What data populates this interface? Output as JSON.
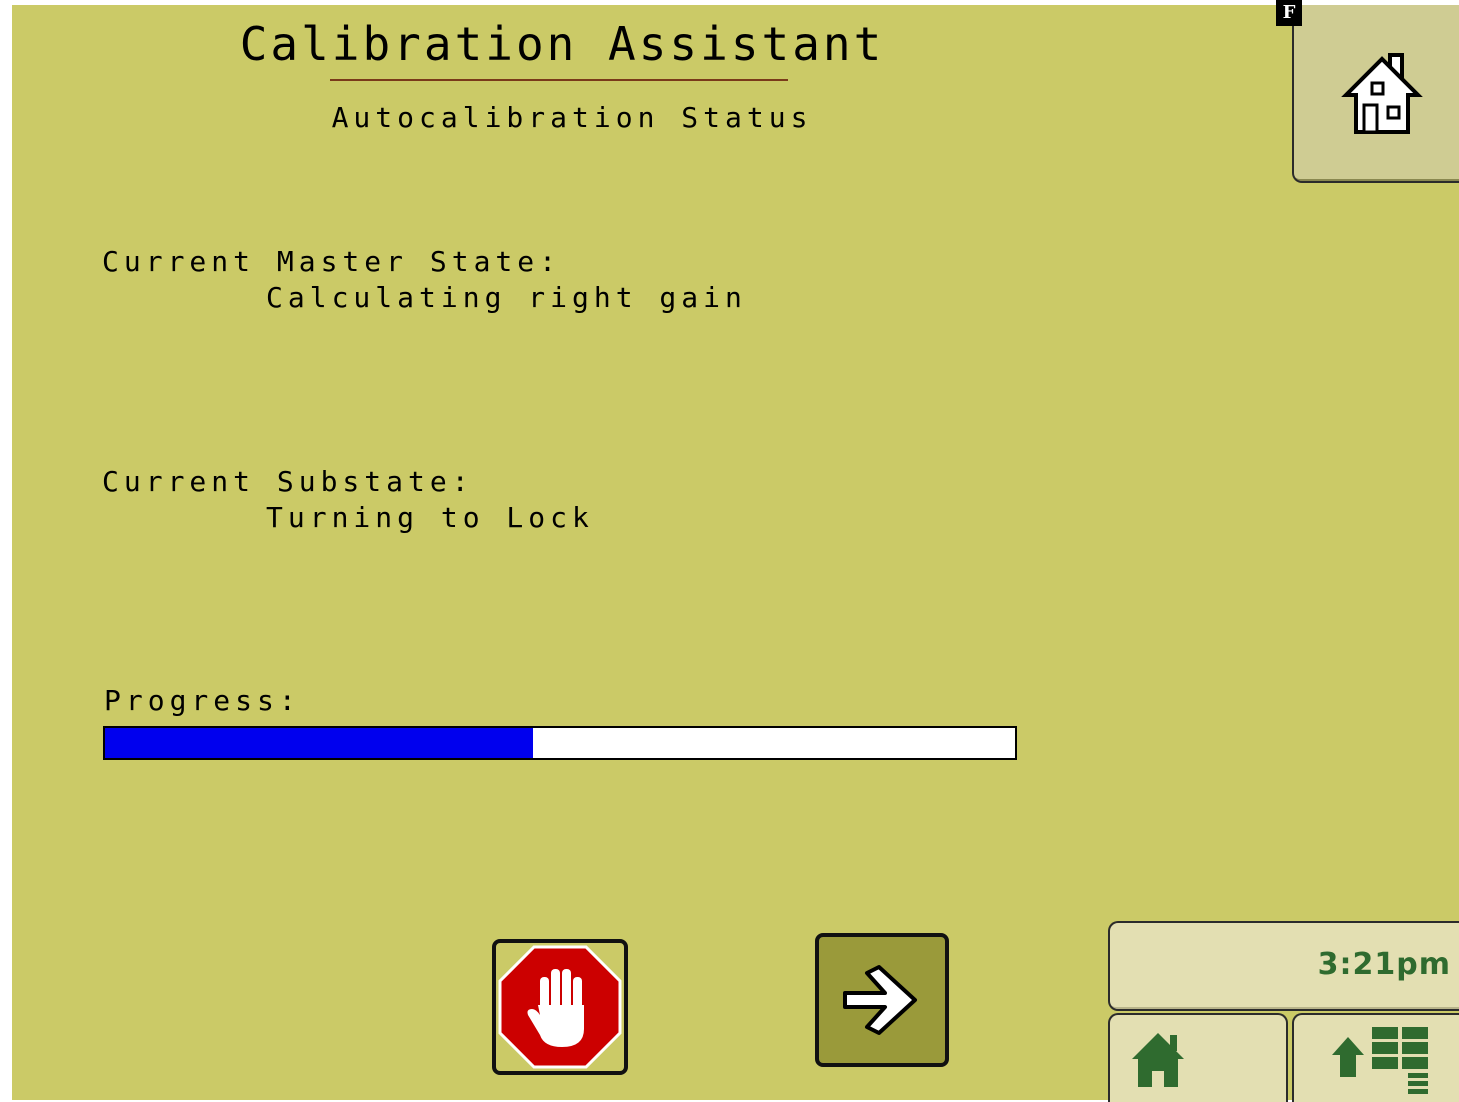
{
  "header": {
    "title": "Calibration Assistant",
    "subtitle": "Autocalibration Status",
    "badge": "F"
  },
  "status": {
    "master_state_label": "Current Master State:",
    "master_state_value": "Calculating right gain",
    "substate_label": "Current Substate:",
    "substate_value": "Turning to Lock"
  },
  "progress": {
    "label": "Progress:",
    "fraction": 0.47,
    "fill_color": "#0000ee",
    "track_color": "#ffffff"
  },
  "footer": {
    "clock": "3:21pm",
    "clock_color": "#2f6b2f"
  },
  "icons": {
    "home": "home-icon",
    "stop": "stop-hand-icon",
    "next": "arrow-right-icon",
    "soft_home": "home-icon",
    "soft_menu": "menu-up-icon"
  },
  "colors": {
    "background": "#cbca67",
    "stop_red": "#cc0000",
    "next_olive": "#9a9a3a",
    "icon_green": "#2f6b2f"
  }
}
